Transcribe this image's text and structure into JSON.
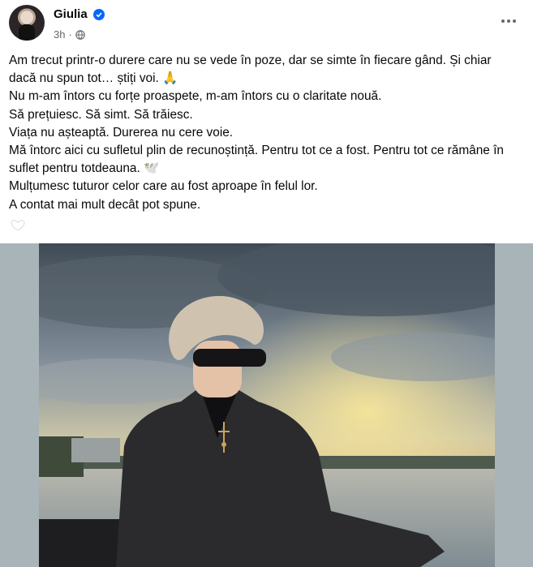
{
  "post": {
    "author": "Giulia",
    "time": "3h",
    "body": "Am trecut printr-o durere care nu se vede în poze, dar se simte în fiecare gând. Și chiar dacă nu spun tot… știți voi. 🙏\nNu m-am întors cu forțe proaspete, m-am întors cu o claritate nouă.\nSă prețuiesc. Să simt. Să trăiesc.\nViața nu așteaptă. Durerea nu cere voie.\nMă întorc aici cu sufletul plin de recunoștință. Pentru tot ce a fost. Pentru tot ce rămâne în suflet pentru totdeauna. 🕊️\nMulțumesc tuturor celor care au fost aproape în felul lor.\nA contat mai mult decât pot spune."
  },
  "icons": {
    "verified": "verified-badge-icon",
    "audience": "globe-icon",
    "more": "more-options-icon",
    "heart": "white-heart-icon"
  },
  "colors": {
    "text": "#080809",
    "secondary": "#65676b",
    "verified": "#0866ff"
  }
}
